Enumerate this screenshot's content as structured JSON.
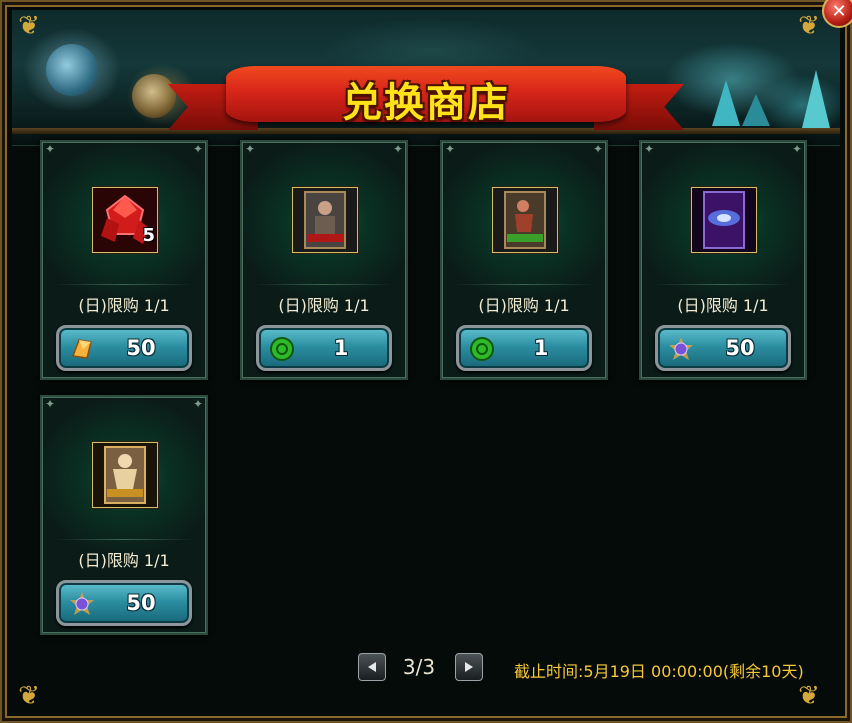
{
  "title": "兑换商店",
  "items": [
    {
      "limit": "(日)限购 1/1",
      "count": "5",
      "price": "50",
      "icon": "red-gem-icon",
      "currency": "amber-crystal-icon"
    },
    {
      "limit": "(日)限购 1/1",
      "count": "",
      "price": "1",
      "icon": "warrior-card-icon",
      "currency": "green-token-icon"
    },
    {
      "limit": "(日)限购 1/1",
      "count": "",
      "price": "1",
      "icon": "archer-card-icon",
      "currency": "green-token-icon"
    },
    {
      "limit": "(日)限购 1/1",
      "count": "",
      "price": "50",
      "icon": "galaxy-card-icon",
      "currency": "purple-badge-icon"
    },
    {
      "limit": "(日)限购 1/1",
      "count": "",
      "price": "50",
      "icon": "angel-card-icon",
      "currency": "purple-badge-icon"
    }
  ],
  "pager": {
    "current": "3/3"
  },
  "deadline": "截止时间:5月19日 00:00:00(剩余10天)"
}
